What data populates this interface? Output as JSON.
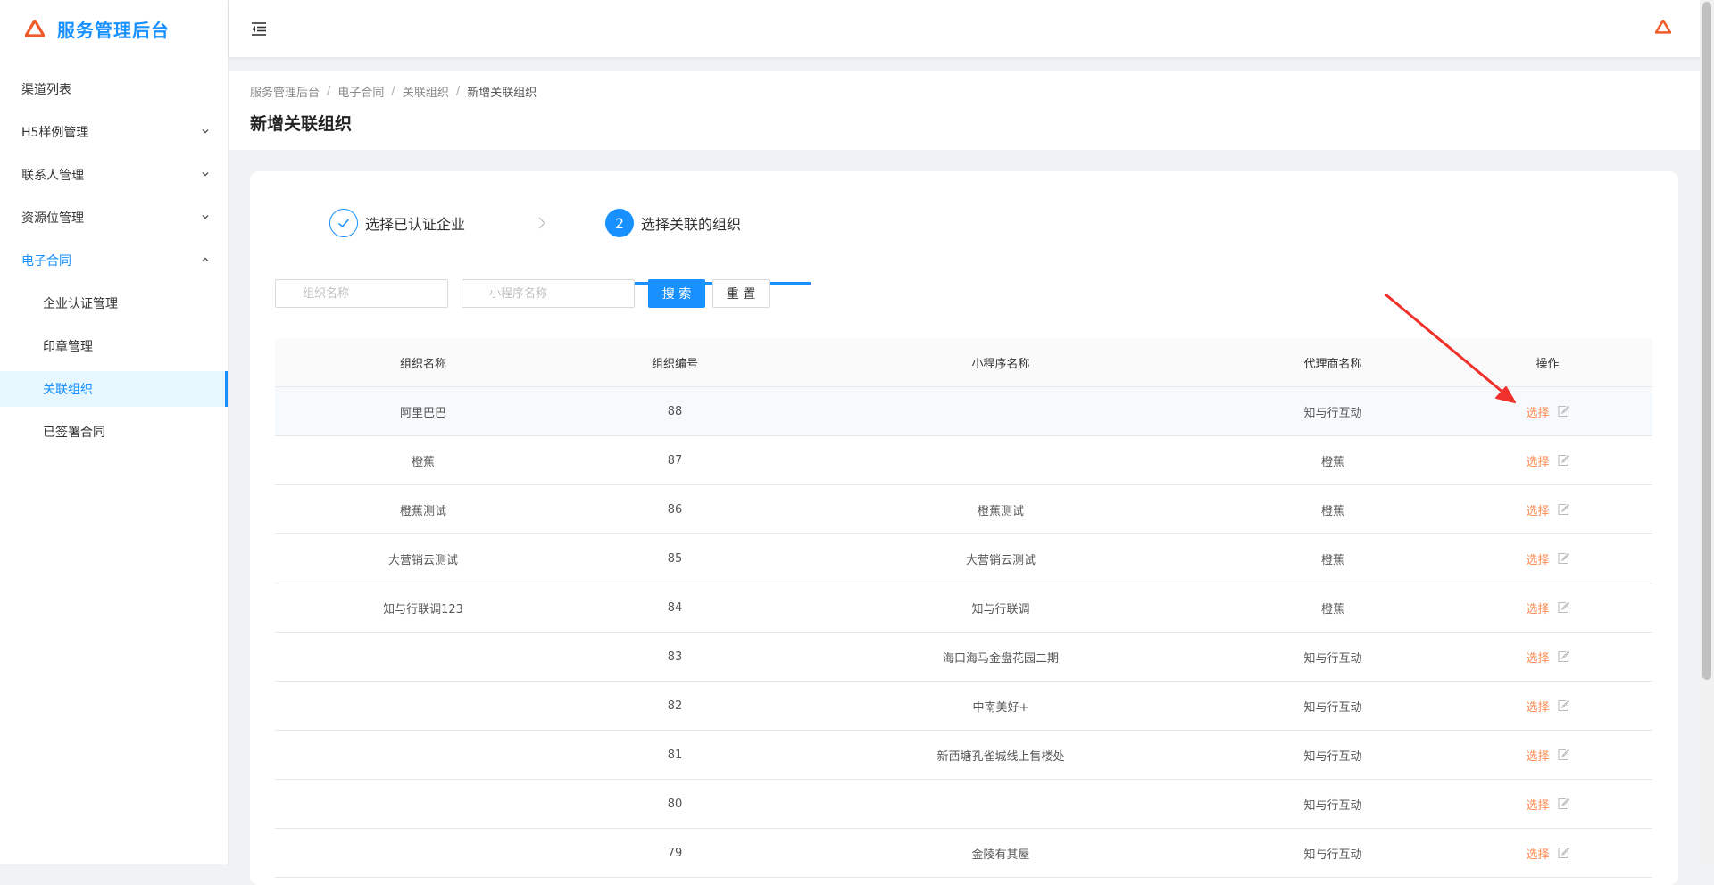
{
  "app": {
    "title": "服务管理后台",
    "brand_color": "#1890ff"
  },
  "sidebar": {
    "items": [
      {
        "label": "渠道列表"
      },
      {
        "label": "H5样例管理"
      },
      {
        "label": "联系人管理"
      },
      {
        "label": "资源位管理"
      },
      {
        "label": "电子合同"
      }
    ],
    "subitems": [
      {
        "label": "企业认证管理"
      },
      {
        "label": "印章管理"
      },
      {
        "label": "关联组织"
      },
      {
        "label": "已签署合同"
      }
    ]
  },
  "breadcrumb": [
    "服务管理后台",
    "电子合同",
    "关联组织",
    "新增关联组织"
  ],
  "page_title": "新增关联组织",
  "steps": [
    {
      "label": "选择已认证企业",
      "status": "done"
    },
    {
      "number": "2",
      "label": "选择关联的组织",
      "status": "current"
    }
  ],
  "search": {
    "org_placeholder": "组织名称",
    "app_placeholder": "小程序名称",
    "search_label": "搜 索",
    "reset_label": "重 置"
  },
  "table": {
    "headers": [
      "组织名称",
      "组织编号",
      "小程序名称",
      "代理商名称",
      "操作"
    ],
    "action_label": "选择",
    "rows": [
      {
        "name": "阿里巴巴",
        "id": "88",
        "app": "",
        "agent": "知与行互动"
      },
      {
        "name": "橙蕉",
        "id": "87",
        "app": "",
        "agent": "橙蕉"
      },
      {
        "name": "橙蕉测试",
        "id": "86",
        "app": "橙蕉测试",
        "agent": "橙蕉"
      },
      {
        "name": "大营销云测试",
        "id": "85",
        "app": "大营销云测试",
        "agent": "橙蕉"
      },
      {
        "name": "知与行联调123",
        "id": "84",
        "app": "知与行联调",
        "agent": "橙蕉"
      },
      {
        "name": "",
        "id": "83",
        "app": "海口海马金盘花园二期",
        "agent": "知与行互动"
      },
      {
        "name": "",
        "id": "82",
        "app": "中南美好+",
        "agent": "知与行互动"
      },
      {
        "name": "",
        "id": "81",
        "app": "新西塘孔雀城线上售楼处",
        "agent": "知与行互动"
      },
      {
        "name": "",
        "id": "80",
        "app": "",
        "agent": "知与行互动"
      },
      {
        "name": "",
        "id": "79",
        "app": "金陵有其屋",
        "agent": "知与行互动"
      }
    ]
  },
  "colors": {
    "action": "#ff8a50",
    "annotation_arrow": "#f0302a",
    "logo": "#f05a28"
  },
  "icons": {
    "menu_fold": "menu-fold-icon",
    "logo": "triangle-logo-icon",
    "edit": "edit-icon"
  }
}
